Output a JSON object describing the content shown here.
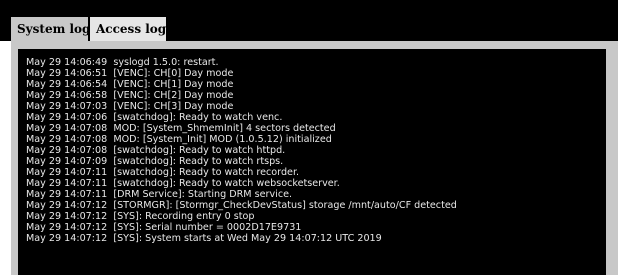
{
  "tabs": [
    {
      "label": "System log"
    },
    {
      "label": "Access log"
    }
  ],
  "log_lines": [
    "May 29 14:06:49  syslogd 1.5.0: restart.",
    "May 29 14:06:51  [VENC]: CH[0] Day mode",
    "May 29 14:06:54  [VENC]: CH[1] Day mode",
    "May 29 14:06:58  [VENC]: CH[2] Day mode",
    "May 29 14:07:03  [VENC]: CH[3] Day mode",
    "May 29 14:07:06  [swatchdog]: Ready to watch venc.",
    "May 29 14:07:08  MOD: [System_ShmemInit] 4 sectors detected",
    "May 29 14:07:08  MOD: [System_Init] MOD (1.0.5.12) initialized",
    "May 29 14:07:08  [swatchdog]: Ready to watch httpd.",
    "May 29 14:07:09  [swatchdog]: Ready to watch rtsps.",
    "May 29 14:07:11  [swatchdog]: Ready to watch recorder.",
    "May 29 14:07:11  [swatchdog]: Ready to watch websocketserver.",
    "May 29 14:07:11  [DRM Service]: Starting DRM service.",
    "May 29 14:07:12  [STORMGR]: [Stormgr_CheckDevStatus] storage /mnt/auto/CF detected",
    "May 29 14:07:12  [SYS]: Recording entry 0 stop",
    "May 29 14:07:12  [SYS]: Serial number = 0002D17E9731",
    "May 29 14:07:12  [SYS]: System starts at Wed May 29 14:07:12 UTC 2019"
  ]
}
